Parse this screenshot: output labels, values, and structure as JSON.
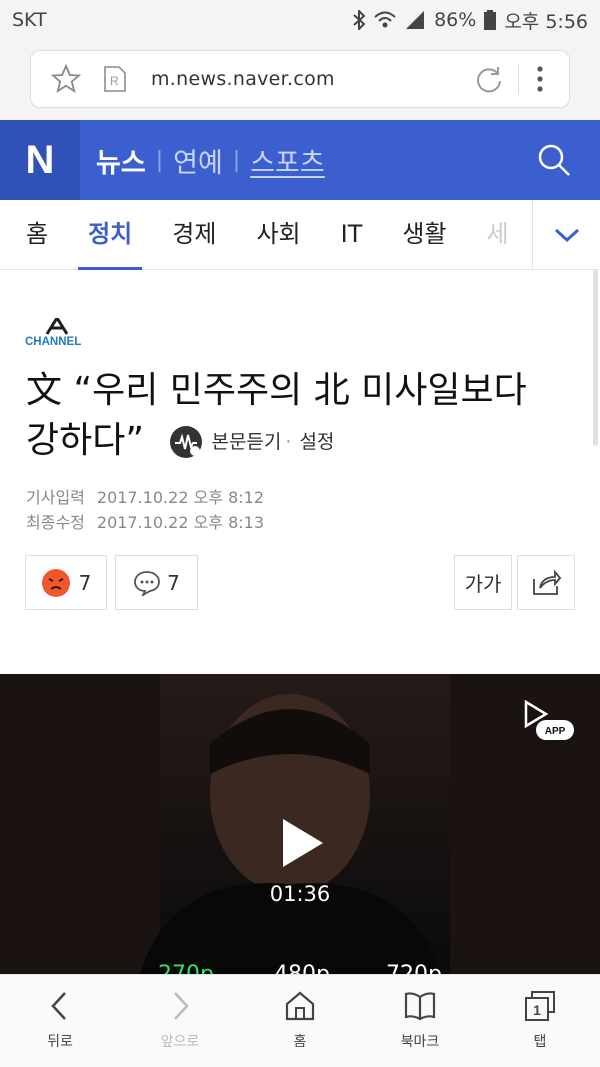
{
  "status_bar": {
    "carrier": "SKT",
    "battery": "86%",
    "time": "오후 5:56"
  },
  "browser": {
    "url": "m.news.naver.com"
  },
  "header": {
    "logo": "N",
    "links": [
      "뉴스",
      "연예",
      "스포츠"
    ]
  },
  "categories": {
    "tabs": [
      "홈",
      "정치",
      "경제",
      "사회",
      "IT",
      "생활",
      "세"
    ],
    "active": "정치"
  },
  "article": {
    "press_logo": "CHANNEL A",
    "press_name": "CHANNEL",
    "title_line1": "文 “우리 민주주의 北 미사일보다",
    "title_line2": "강하다”",
    "tts_label": "본문듣기",
    "tts_settings": "설정",
    "input_label": "기사입력",
    "input_time": "2017.10.22 오후 8:12",
    "update_label": "최종수정",
    "update_time": "2017.10.22 오후 8:13",
    "reaction_count": "7",
    "comment_count": "7",
    "font_size_label": "가가"
  },
  "video": {
    "duration": "01:36",
    "app_badge": "APP",
    "qualities": [
      "270p",
      "480p",
      "720p"
    ]
  },
  "bottom_nav": {
    "back": "뒤로",
    "forward": "앞으로",
    "home": "홈",
    "bookmark": "북마크",
    "tabs": "탭",
    "tab_count": "1"
  }
}
